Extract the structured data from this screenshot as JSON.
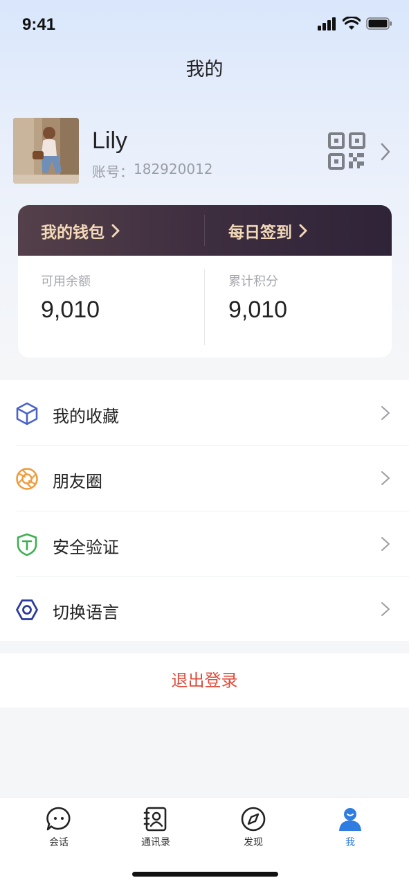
{
  "status_bar": {
    "time": "9:41"
  },
  "page": {
    "title": "我的"
  },
  "profile": {
    "name": "Lily",
    "account_label": "账号：",
    "account_number": "182920012"
  },
  "wallet_card": {
    "wallet_link": "我的钱包",
    "checkin_link": "每日签到",
    "balance_label": "可用余额",
    "balance_value": "9,010",
    "points_label": "累计积分",
    "points_value": "9,010"
  },
  "menu": {
    "items": [
      {
        "label": "我的收藏",
        "icon": "cube-icon",
        "color": "#4a63c9"
      },
      {
        "label": "朋友圈",
        "icon": "aperture-icon",
        "color": "#ef9b3c"
      },
      {
        "label": "安全验证",
        "icon": "shield-icon",
        "color": "#3db051"
      },
      {
        "label": "切换语言",
        "icon": "hexagon-nut-icon",
        "color": "#2b3a9c"
      }
    ]
  },
  "logout": {
    "label": "退出登录",
    "color": "#e04b3a"
  },
  "tabbar": {
    "tabs": [
      {
        "label": "会话",
        "icon": "chat-bubble-icon"
      },
      {
        "label": "通讯录",
        "icon": "contacts-icon"
      },
      {
        "label": "发现",
        "icon": "compass-icon"
      },
      {
        "label": "我",
        "icon": "person-icon",
        "active": true
      }
    ],
    "active_color": "#2f7de1"
  }
}
